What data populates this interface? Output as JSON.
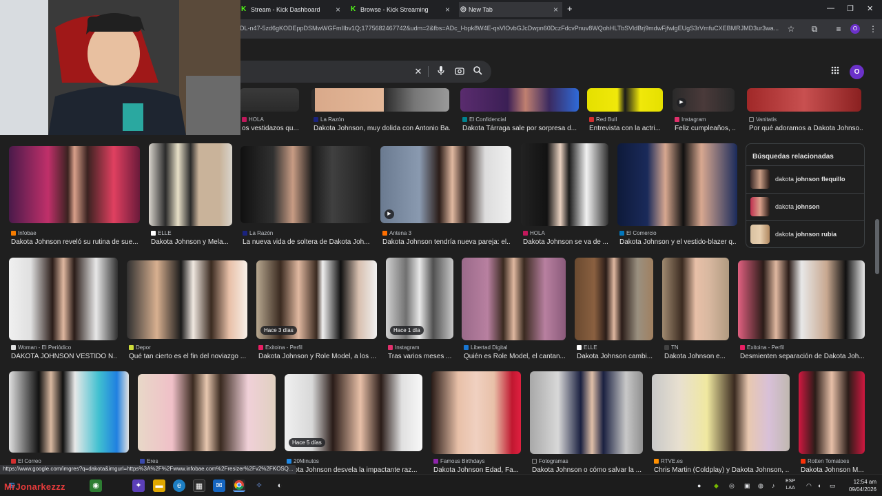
{
  "tabs": [
    {
      "title": "Stream - Kick Dashboard",
      "icon": "kick-icon"
    },
    {
      "title": "Browse - Kick Streaming",
      "icon": "kick-icon"
    },
    {
      "title": "New Tab",
      "icon": "chrome-icon"
    }
  ],
  "new_tab_symbol": "+",
  "url": "DL-n47-5zd6gKODEppDSMwWGFmIIbv1Q;1775682467742&udm=2&fbs=ADc_l-bpk8W4E-qsVlOvbGJcDwpn60DczFdcvPnuv8WQohHLTbSVldBrj9mdwFjfwlgEUgS3rVmfuCXEBMRJMD3ur3wa...",
  "profile_initial": "O",
  "search": {
    "clear_symbol": "✕"
  },
  "top_row": [
    {
      "source": "HOLA",
      "title": "os vestidazos qu...",
      "color": "#c2185b"
    },
    {
      "source": "La Razón",
      "title": "Dakota Johnson, muy dolida con Antonio Ba...",
      "color": "#1a237e"
    },
    {
      "source": "El Confidencial",
      "title": "Dakota Tárraga sale por sorpresa d...",
      "color": "#00838f"
    },
    {
      "source": "Red Bull",
      "title": "Entrevista con la actri...",
      "color": "#d32f2f"
    },
    {
      "source": "Instagram",
      "title": "Feliz cumpleaños, ...",
      "color": "#e1306c"
    },
    {
      "source": "Vanitatis",
      "title": "Por qué adoramos a Dakota Johnso...",
      "color": "#212121"
    }
  ],
  "row2": [
    {
      "source": "Infobae",
      "title": "Dakota Johnson reveló su rutina de sue...",
      "color": "#f57c00"
    },
    {
      "source": "ELLE",
      "title": "Dakota Johnson y Mela...",
      "color": "#ffffff"
    },
    {
      "source": "La Razón",
      "title": "La nueva vida de soltera de Dakota Joh...",
      "color": "#1a237e"
    },
    {
      "source": "Antena 3",
      "title": "Dakota Johnson tendría nueva pareja: el...",
      "color": "#ff6f00"
    },
    {
      "source": "HOLA",
      "title": "Dakota Johnson se va de ...",
      "color": "#c2185b"
    },
    {
      "source": "El Comercio",
      "title": "Dakota Johnson y el vestido-blazer q...",
      "color": "#0277bd"
    }
  ],
  "row3": [
    {
      "source": "Woman - El Periódico",
      "title": "DAKOTA JOHNSON VESTIDO N...",
      "color": "#e0e0e0"
    },
    {
      "source": "Depor",
      "title": "Qué tan cierto es el fin del noviazgo ...",
      "color": "#cddc39",
      "badge": ""
    },
    {
      "source": "Exitoina - Perfil",
      "title": "Dakota Johnson y Role Model, a los ...",
      "color": "#e91e63",
      "badge": "Hace 3 días"
    },
    {
      "source": "Instagram",
      "title": "Tras varios meses ...",
      "color": "#e1306c",
      "badge": "Hace 1 día"
    },
    {
      "source": "Libertad Digital",
      "title": "Quién es Role Model, el cantan...",
      "color": "#1976d2"
    },
    {
      "source": "ELLE",
      "title": "Dakota Johnson cambi...",
      "color": "#ffffff"
    },
    {
      "source": "TN",
      "title": "Dakota Johnson e...",
      "color": "#424242"
    },
    {
      "source": "Exitoina - Perfil",
      "title": "Desmienten separación de Dakota Joh...",
      "color": "#e91e63"
    }
  ],
  "row4": [
    {
      "source": "El Correo",
      "title": "",
      "color": "#d32f2f"
    },
    {
      "source": "Eres",
      "title": "",
      "color": "#3949ab"
    },
    {
      "source": "20Minutos",
      "title": "akota Johnson desvela la impactante raz...",
      "color": "#1e88e5",
      "badge": "Hace 5 días"
    },
    {
      "source": "Famous Birthdays",
      "title": "Dakota Johnson Edad, Fa...",
      "color": "#8e24aa"
    },
    {
      "source": "Fotogramas",
      "title": "Dakota Johnson o cómo salvar la ...",
      "color": "#212121"
    },
    {
      "source": "RTVE.es",
      "title": "Chris Martin (Coldplay) y Dakota Johnson, ...",
      "color": "#ff8f00"
    },
    {
      "source": "Rotten Tomatoes",
      "title": "Dakota Johnson M...",
      "color": "#fa320a"
    }
  ],
  "related": {
    "header": "Búsquedas relacionadas",
    "items": [
      {
        "prefix": "dakota ",
        "bold": "johnson flequillo"
      },
      {
        "prefix": "dakota ",
        "bold": "johnson"
      },
      {
        "prefix": "dakota ",
        "bold": "johnson rubia"
      }
    ]
  },
  "status_url": "https://www.google.com/imgres?q=dakota&imgurl=https%3A%2F%2Fwww.infobae.com%2Fresizer%2Fv2%2FKOSQ...",
  "taskbar": {
    "overlay_name": "MrJonarkezzz",
    "lang_top": "ESP",
    "lang_bottom": "LAA",
    "time": "12:54 am",
    "date": "09/04/2026"
  },
  "colors": {
    "accent": "#6b31c9",
    "bg": "#1f1f1f"
  }
}
